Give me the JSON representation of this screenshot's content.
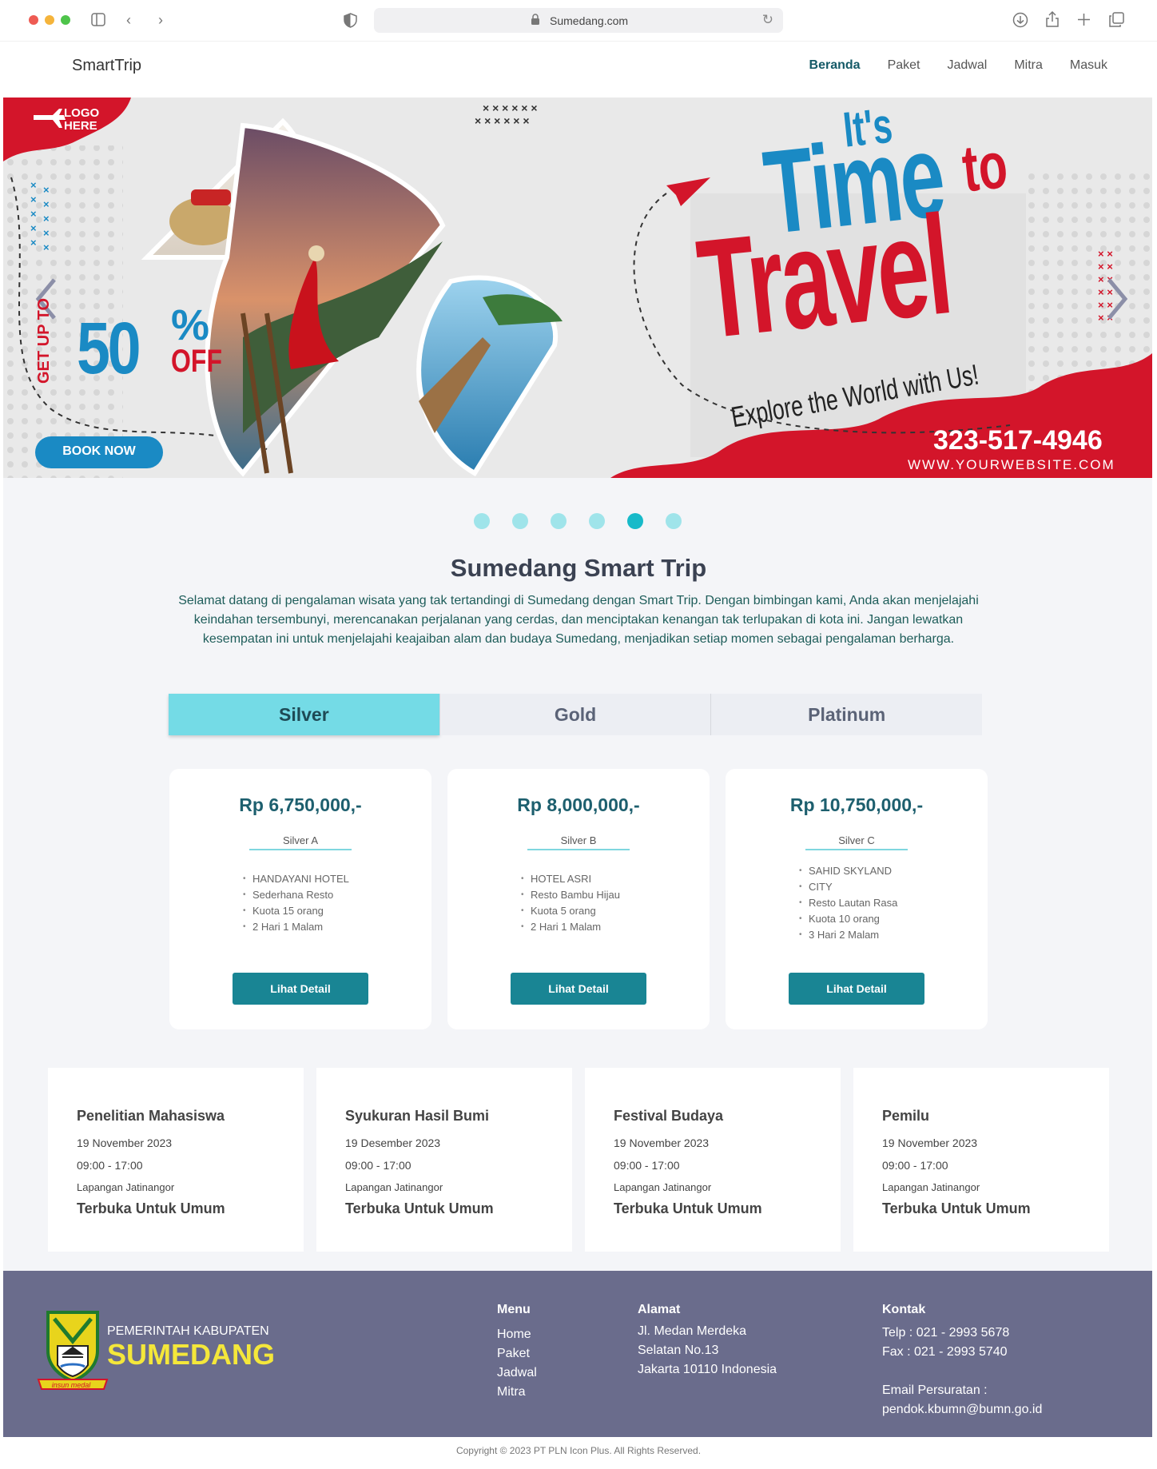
{
  "browser": {
    "url": "Sumedang.com"
  },
  "nav": {
    "brand": "SmartTrip",
    "items": [
      "Beranda",
      "Paket",
      "Jadwal",
      "Mitra",
      "Masuk"
    ],
    "active": "Beranda"
  },
  "banner": {
    "logo_line1": "LOGO",
    "logo_line2": "HERE",
    "get_up_to": "GET UP TO",
    "percent": "50",
    "percent_sign": "%",
    "off": "OFF",
    "book_now": "BOOK NOW",
    "its": "It's",
    "time": "Time",
    "to": "to",
    "travel": "Travel",
    "explore": "Explore the World with Us!",
    "phone": "323-517-4946",
    "website": "WWW.YOURWEBSITE.COM"
  },
  "carousel": {
    "slide_count": 6,
    "active_index": 4
  },
  "intro": {
    "title": "Sumedang Smart Trip",
    "text": "Selamat datang di pengalaman wisata yang tak tertandingi di Sumedang dengan Smart Trip. Dengan bimbingan kami, Anda akan menjelajahi keindahan tersembunyi, merencanakan perjalanan yang cerdas, dan menciptakan kenangan tak terlupakan di kota ini. Jangan lewatkan kesempatan ini untuk menjelajahi keajaiban alam dan budaya Sumedang, menjadikan setiap momen sebagai pengalaman berharga."
  },
  "tabs": [
    "Silver",
    "Gold",
    "Platinum"
  ],
  "packages": [
    {
      "price": "Rp 6,750,000,-",
      "name": "Silver A",
      "features": [
        "HANDAYANI HOTEL",
        "Sederhana Resto",
        "Kuota 15 orang",
        "2 Hari  1 Malam"
      ],
      "button": "Lihat Detail"
    },
    {
      "price": "Rp 8,000,000,-",
      "name": "Silver B",
      "features": [
        "HOTEL ASRI",
        "Resto Bambu Hijau",
        "Kuota 5 orang",
        "2 Hari  1 Malam"
      ],
      "button": "Lihat Detail"
    },
    {
      "price": "Rp 10,750,000,-",
      "name": "Silver C",
      "features": [
        "SAHID SKYLAND",
        "CITY",
        "Resto Lautan Rasa",
        "Kuota 10 orang",
        "3 Hari 2 Malam"
      ],
      "button": "Lihat Detail"
    }
  ],
  "events": [
    {
      "title": "Penelitian Mahasiswa",
      "date": "19 November 2023",
      "time": "09:00 - 17:00",
      "place": "Lapangan Jatinangor",
      "open": "Terbuka Untuk Umum"
    },
    {
      "title": "Syukuran Hasil Bumi",
      "date": "19 Desember 2023",
      "time": "09:00 - 17:00",
      "place": "Lapangan Jatinangor",
      "open": "Terbuka Untuk Umum"
    },
    {
      "title": "Festival Budaya",
      "date": "19 November 2023",
      "time": "09:00 - 17:00",
      "place": "Lapangan Jatinangor",
      "open": "Terbuka Untuk Umum"
    },
    {
      "title": "Pemilu",
      "date": "19 November 2023",
      "time": "09:00 - 17:00",
      "place": "Lapangan Jatinangor",
      "open": "Terbuka Untuk Umum"
    }
  ],
  "footer": {
    "gov_line": "PEMERINTAH KABUPATEN",
    "gov_name": "SUMEDANG",
    "emblem_motto": "insun medal",
    "menu_title": "Menu",
    "menu_items": [
      "Home",
      "Paket",
      "Jadwal",
      "Mitra"
    ],
    "address_title": "Alamat",
    "address_lines": [
      "Jl. Medan Merdeka",
      "Selatan No.13",
      "Jakarta 10110 Indonesia"
    ],
    "contact_title": "Kontak",
    "contact_lines": [
      "Telp : 021 - 2993 5678",
      "Fax : 021 - 2993 5740"
    ],
    "email_label": "Email Persuratan :",
    "email": "pendok.kbumn@bumn.go.id"
  },
  "copyright": "Copyright © 2023 PT PLN Icon Plus. All Rights Reserved.",
  "colors": {
    "accent": "#17bac9",
    "tab_active": "#74dbe6",
    "button": "#198594",
    "footer": "#6a6c8c",
    "banner_red": "#d3152a",
    "banner_blue": "#1a8ac4"
  }
}
